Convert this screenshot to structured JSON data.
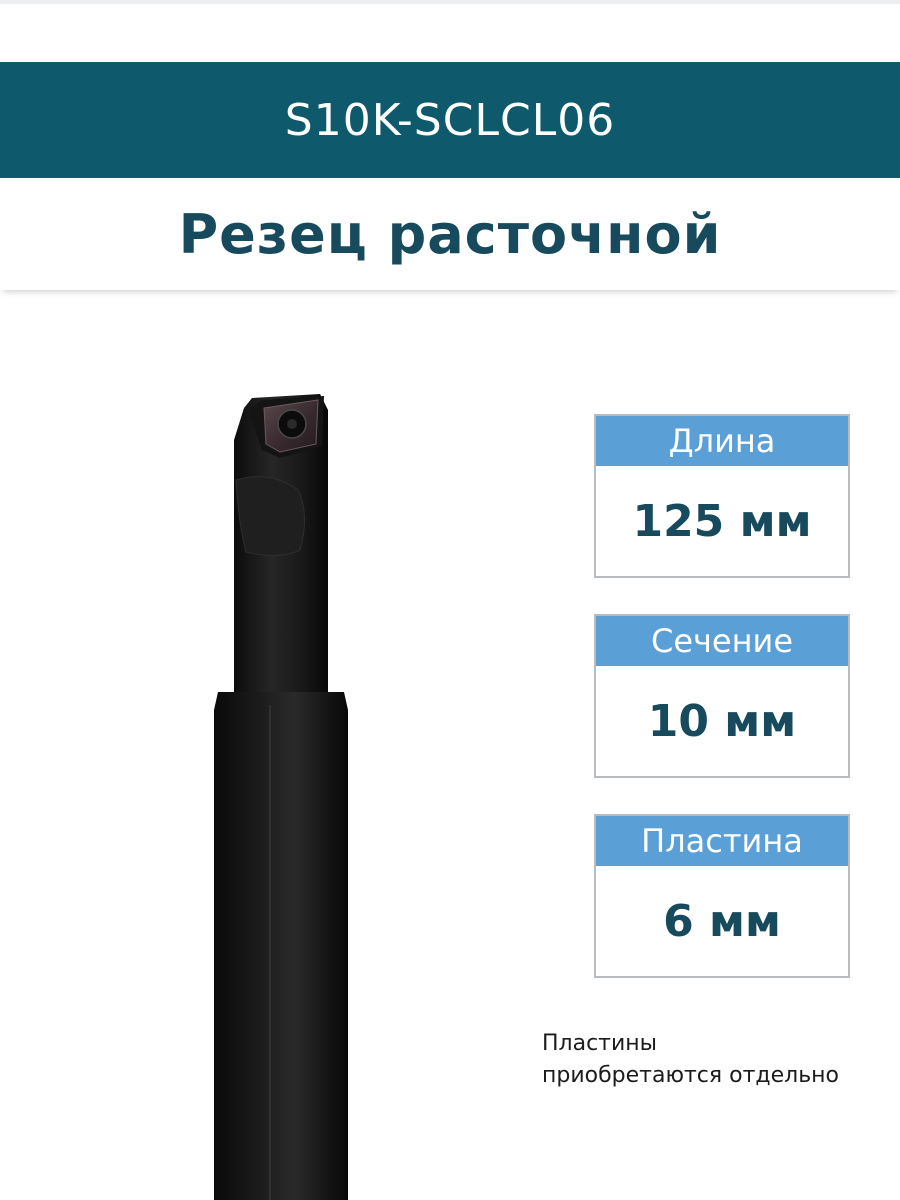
{
  "header": {
    "model": "S10K-SCLCL06",
    "title": "Резец расточной"
  },
  "specs": [
    {
      "label": "Длина",
      "value": "125 мм"
    },
    {
      "label": "Сечение",
      "value": "10 мм"
    },
    {
      "label": "Пластина",
      "value": "6 мм"
    }
  ],
  "note": {
    "line1": "Пластины",
    "line2": "приобретаются отдельно"
  },
  "colors": {
    "banner": "#0e5a6c",
    "title_text": "#174a5c",
    "spec_header": "#5a9fd6",
    "spec_border": "#b8bcbf",
    "tool_body": "#111111"
  },
  "icons": {
    "product_image": "boring-bar-tool-image"
  }
}
